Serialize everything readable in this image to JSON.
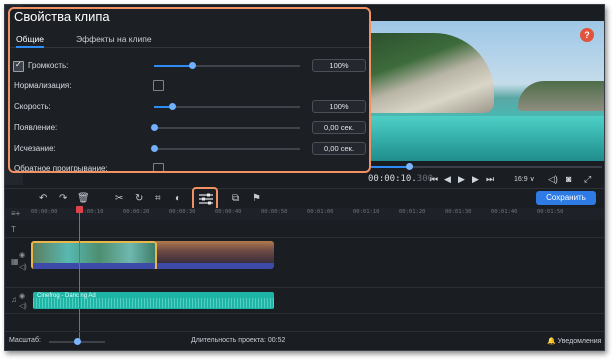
{
  "panel": {
    "title": "Свойства клипа",
    "tabs": [
      {
        "label": "Общие",
        "active": true
      },
      {
        "label": "Эффекты на клипе",
        "active": false
      }
    ],
    "rows": {
      "volume": {
        "label": "Громкость:",
        "checked": true,
        "value": "100%",
        "slider_level": 0.26
      },
      "normalization": {
        "label": "Нормализация:",
        "checked": false
      },
      "speed": {
        "label": "Скорость:",
        "value": "100%",
        "slider_level": 0.12
      },
      "fade_in": {
        "label": "Появление:",
        "value": "0,00 сек.",
        "slider_level": 0.0
      },
      "fade_out": {
        "label": "Исчезание:",
        "value": "0,00 сек.",
        "slider_level": 0.0
      },
      "reverse": {
        "label": "Обратное проигрывание:",
        "checked": false
      }
    }
  },
  "player": {
    "timecode_main": "00:00:10.",
    "timecode_ms": "300",
    "playback_progress": 0.17,
    "aspect": "16:9 ∨"
  },
  "toolbar": {
    "save_label": "Сохранить"
  },
  "timeline": {
    "ruler": [
      "00:00:00",
      "00:00:10",
      "00:00:20",
      "00:00:30",
      "00:00:40",
      "00:00:50",
      "00:01:00",
      "00:01:10",
      "00:01:20",
      "00:01:30",
      "00:01:40",
      "00:01:50",
      "00:02:00"
    ],
    "music_clip_label": "Cinefrog - Dancing Ad"
  },
  "status": {
    "zoom_label": "Масштаб:",
    "duration": "Длительность проекта: 00:52",
    "notifications": "Уведомления"
  },
  "colors": {
    "accent": "#2f8cf5",
    "highlight": "#f29162",
    "save_button": "#2e7be6",
    "playhead": "#e0414a",
    "help_badge": "#e2533b"
  }
}
